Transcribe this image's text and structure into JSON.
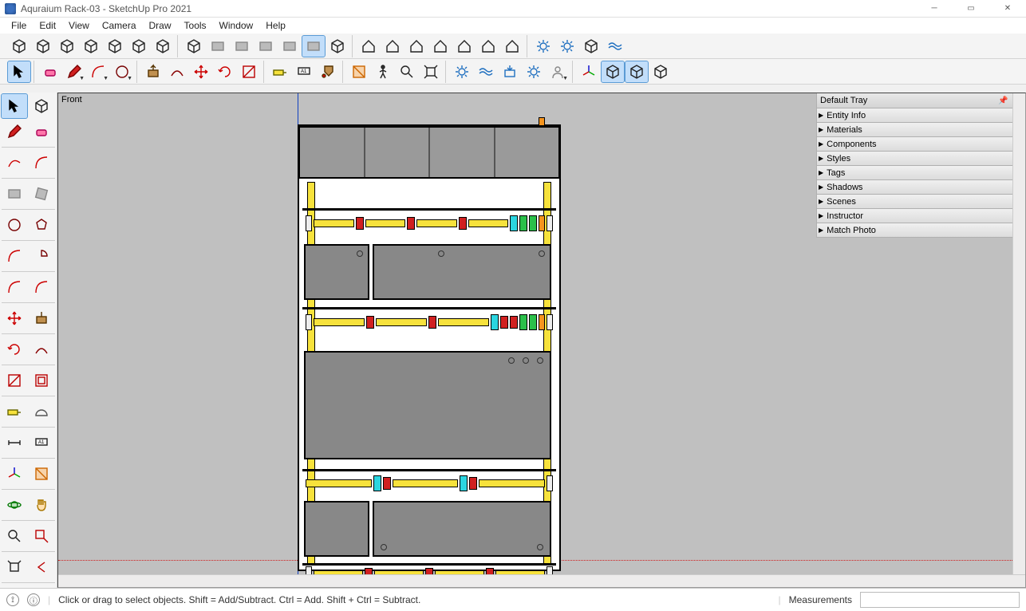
{
  "window": {
    "title": "Aquraium Rack-03 - SketchUp Pro 2021"
  },
  "menus": [
    "File",
    "Edit",
    "View",
    "Camera",
    "Draw",
    "Tools",
    "Window",
    "Help"
  ],
  "viewport": {
    "label": "Front"
  },
  "tray": {
    "title": "Default Tray",
    "sections": [
      "Entity Info",
      "Materials",
      "Components",
      "Styles",
      "Tags",
      "Shadows",
      "Scenes",
      "Instructor",
      "Match Photo"
    ]
  },
  "status": {
    "hint": "Click or drag to select objects. Shift = Add/Subtract. Ctrl = Add. Shift + Ctrl = Subtract.",
    "measure_label": "Measurements"
  },
  "toolbar_row1": [
    [
      "make-component",
      "outliner",
      "tag-tool",
      "layers",
      "solid-tools",
      "solid-union",
      "solid-subtract"
    ],
    [
      "iso-view",
      "top-view",
      "bottom-view",
      "side-view",
      "back-view",
      "front-view",
      "perspective"
    ],
    [
      "house-full",
      "house-front",
      "house-iso",
      "house-plan",
      "house-wire",
      "house-xray",
      "house-section"
    ],
    [
      "extension-wh-1",
      "extension-wh-2",
      "ext-grey-1",
      "ext-wave"
    ]
  ],
  "toolbar_row2": [
    [
      "select-arrow"
    ],
    [
      "eraser",
      "line",
      "arc",
      "circle"
    ],
    [
      "pushpull",
      "follow-me",
      "move",
      "rotate",
      "scale"
    ],
    [
      "tape",
      "text-label",
      "paint-bucket"
    ],
    [
      "sectionplane",
      "walk",
      "zoom",
      "zoom-extents"
    ],
    [
      "geo-locate",
      "add-location",
      "3d-warehouse-get",
      "3d-warehouse-set",
      "account"
    ],
    [
      "axes",
      "hidden-geom-1",
      "hidden-geom-2",
      "guides"
    ]
  ],
  "left_tools": [
    "select",
    "select-all",
    "line-tool",
    "eraser-tool",
    "",
    "freehand",
    "arc2",
    "",
    "rectangle",
    "rotated-rect",
    "",
    "circle-tool",
    "polygon",
    "",
    "arc-tool",
    "pie",
    "",
    "arc3",
    "2pt-arc",
    "",
    "move-tool",
    "pushpull-tool",
    "",
    "rotate-tool",
    "followme-tool",
    "",
    "scale-tool",
    "offset-tool",
    "",
    "tape-measure",
    "protractor",
    "",
    "dimension",
    "text-tool",
    "",
    "axes-tool",
    "section-tool",
    "",
    "orbit-tool",
    "pan-tool",
    "",
    "zoom-tool",
    "zoom-window",
    "",
    "zoom-extents-tool",
    "prev-view",
    "",
    "position-camera",
    "look-around"
  ]
}
